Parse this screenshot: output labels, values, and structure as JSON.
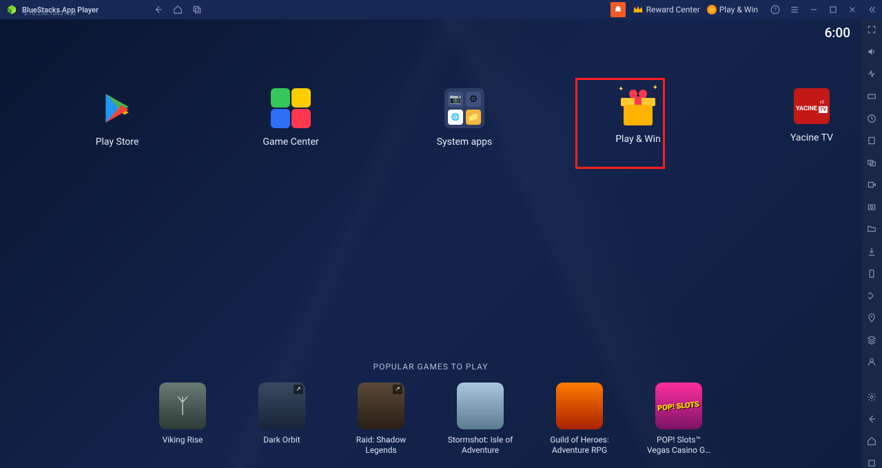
{
  "titlebar": {
    "app_name": "BlueStacks App Player",
    "version": "5.10.230.1003  N32",
    "reward_label": "Reward Center",
    "playwin_label": "Play & Win"
  },
  "clock": "6:00",
  "apps": [
    {
      "label": "Play Store"
    },
    {
      "label": "Game Center"
    },
    {
      "label": "System apps"
    },
    {
      "label": "Play & Win"
    },
    {
      "label": "Yacine TV"
    }
  ],
  "yacine_text": "YACINE",
  "yacine_tv": "TV",
  "popular": {
    "title": "POPULAR GAMES TO PLAY",
    "items": [
      {
        "label": "Viking Rise"
      },
      {
        "label": "Dark Orbit"
      },
      {
        "label": "Raid: Shadow Legends"
      },
      {
        "label": "Stormshot: Isle of Adventure"
      },
      {
        "label": "Guild of Heroes: Adventure RPG"
      },
      {
        "label": "POP! Slots™ Vegas Casino G…"
      }
    ]
  },
  "pop_slots_text": "POP! SLOTS"
}
